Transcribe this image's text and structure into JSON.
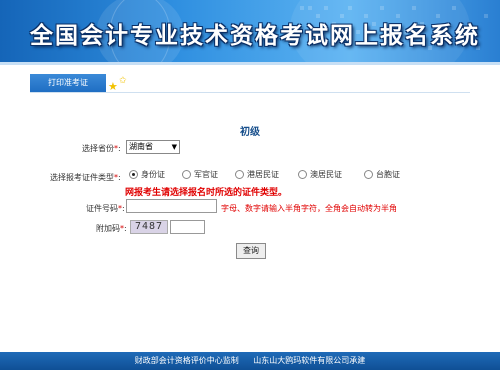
{
  "banner": {
    "title": "全国会计专业技术资格考试网上报名系统"
  },
  "tabs": [
    {
      "label": "打印准考证"
    }
  ],
  "form": {
    "level": "初级",
    "province": {
      "label": "选择省份",
      "required_mark": "*",
      "value": "湖南省"
    },
    "id_type": {
      "label": "选择报考证件类型",
      "required_mark": "*",
      "options": [
        "身份证",
        "军官证",
        "港居民证",
        "澳居民证",
        "台胞证"
      ],
      "selected": "身份证",
      "warning": "网报考生请选择报名时所选的证件类型。"
    },
    "id_number": {
      "label": "证件号码",
      "required_mark": "*",
      "value": "",
      "hint": "字母、数字请输入半角字符，全角会自动转为半角"
    },
    "captcha": {
      "label": "附加码",
      "required_mark": "*",
      "image_text": "7487",
      "value": ""
    },
    "submit_label": "查询"
  },
  "footer": {
    "supervisor": "财政部会计资格评价中心监制",
    "developer": "山东山大鸥玛软件有限公司承建"
  },
  "colors": {
    "banner": "#2f8fe0",
    "tab": "#1f6ec3",
    "footer": "#0f4f95",
    "warning": "#e00000",
    "star": "#f2c200"
  }
}
